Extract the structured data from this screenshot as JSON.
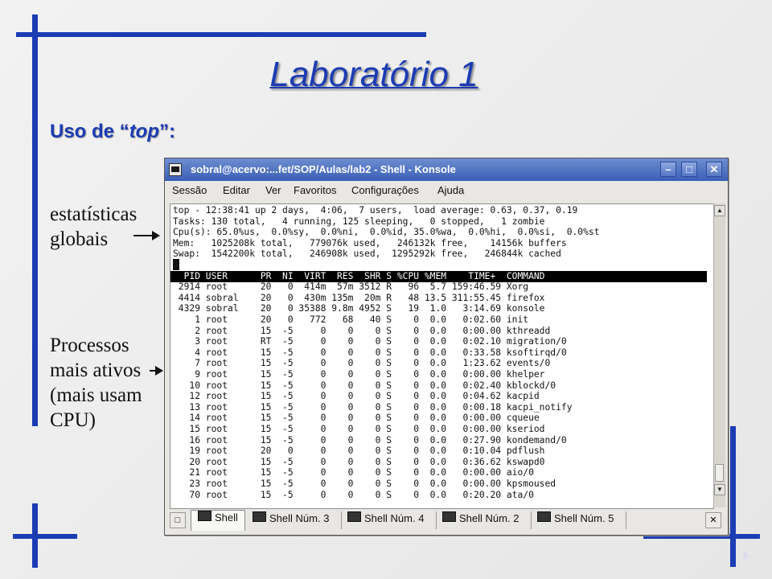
{
  "slide": {
    "title": "Laboratório 1",
    "subtitle_prefix": "Uso de “",
    "subtitle_emph": "top",
    "subtitle_suffix": "”:",
    "note_stats": [
      "estatísticas",
      "globais"
    ],
    "note_procs": [
      "Processos",
      "mais ativos",
      "(mais usam",
      "CPU)"
    ],
    "page_number": "5",
    "accent_color": "#1c3cb4"
  },
  "window": {
    "title": "sobral@acervo:...fet/SOP/Aulas/lab2 - Shell - Konsole",
    "titlebar_color": "#3b5fb6",
    "buttons": {
      "minimize": "minimize-icon",
      "maximize": "maximize-icon",
      "close": "close-icon"
    },
    "menu": [
      "Sessão",
      "Editar",
      "Ver",
      "Favoritos",
      "Configurações",
      "Ajuda"
    ]
  },
  "terminal": {
    "summary": [
      "top - 12:38:41 up 2 days,  4:06,  7 users,  load average: 0.63, 0.37, 0.19",
      "Tasks: 130 total,   4 running, 125 sleeping,   0 stopped,   1 zombie",
      "Cpu(s): 65.0%us,  0.0%sy,  0.0%ni,  0.0%id, 35.0%wa,  0.0%hi,  0.0%si,  0.0%st",
      "Mem:   1025208k total,   779076k used,   246132k free,    14156k buffers",
      "Swap:  1542200k total,   246908k used,  1295292k free,   246844k cached"
    ],
    "header": "  PID USER      PR  NI  VIRT  RES  SHR S %CPU %MEM    TIME+  COMMAND",
    "processes": [
      " 2914 root      20   0  414m  57m 3512 R   96  5.7 159:46.59 Xorg",
      " 4414 sobral    20   0  430m 135m  20m R   48 13.5 311:55.45 firefox",
      " 4329 sobral    20   0 35388 9.8m 4952 S   19  1.0   3:14.69 konsole",
      "    1 root      20   0   772   68   40 S    0  0.0   0:02.60 init",
      "    2 root      15  -5     0    0    0 S    0  0.0   0:00.00 kthreadd",
      "    3 root      RT  -5     0    0    0 S    0  0.0   0:02.10 migration/0",
      "    4 root      15  -5     0    0    0 S    0  0.0   0:33.58 ksoftirqd/0",
      "    7 root      15  -5     0    0    0 S    0  0.0   1:23.62 events/0",
      "    9 root      15  -5     0    0    0 S    0  0.0   0:00.00 khelper",
      "   10 root      15  -5     0    0    0 S    0  0.0   0:02.40 kblockd/0",
      "   12 root      15  -5     0    0    0 S    0  0.0   0:04.62 kacpid",
      "   13 root      15  -5     0    0    0 S    0  0.0   0:00.18 kacpi_notify",
      "   14 root      15  -5     0    0    0 S    0  0.0   0:00.00 cqueue",
      "   15 root      15  -5     0    0    0 S    0  0.0   0:00.00 kseriod",
      "   16 root      15  -5     0    0    0 S    0  0.0   0:27.90 kondemand/0",
      "   19 root      20   0     0    0    0 S    0  0.0   0:10.04 pdflush",
      "   20 root      15  -5     0    0    0 S    0  0.0   0:36.62 kswapd0",
      "   21 root      15  -5     0    0    0 S    0  0.0   0:00.00 aio/0",
      "   23 root      15  -5     0    0    0 S    0  0.0   0:00.00 kpsmoused",
      "   70 root      15  -5     0    0    0 S    0  0.0   0:20.20 ata/0"
    ]
  },
  "tabs": [
    "Shell",
    "Shell Núm. 3",
    "Shell Núm. 4",
    "Shell Núm. 2",
    "Shell Núm. 5"
  ]
}
